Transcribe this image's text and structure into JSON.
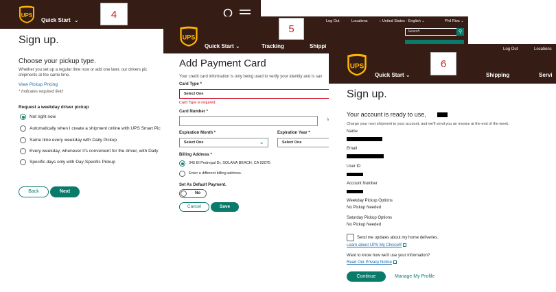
{
  "screen4": {
    "brand": "UPS",
    "nav_quick_start": "Quick Start",
    "step_number": "4",
    "title": "Sign up.",
    "subtitle": "Choose your pickup type.",
    "desc_line1": "Whether you set up a regular time now or add one later, our drivers pic",
    "desc_line2": "shipments at the same time.",
    "view_pricing": "View Pickup Pricing",
    "required_note": "* Indicates required field",
    "question": "Request a weekday driver pickup",
    "options": [
      "Not right now",
      "Automatically when I create a shipment online with UPS Smart Pic",
      "Same time every weekday with Daily Pickup",
      "Every weekday, whenever it's convenient for the driver, with Daily",
      "Specific days only with Day-Specific Pickup"
    ],
    "back_label": "Back",
    "next_label": "Next"
  },
  "screen5": {
    "brand": "UPS",
    "step_number": "5",
    "log_out": "Log Out",
    "locations": "Locations",
    "language": "United States - English",
    "user_name": "Phil Rios",
    "search_placeholder": "Search",
    "nav": [
      "Quick Start",
      "Tracking",
      "Shippi"
    ],
    "title": "Add Payment Card",
    "intro": "Your credit card information is only being used to verify your identity and is sav",
    "card_type_label": "Card Type *",
    "card_type_value": "Select One",
    "card_type_error": "Card Type is required.",
    "card_number_label": "Card Number *",
    "card_number_side": "V",
    "exp_month_label": "Expiration Month *",
    "exp_month_value": "Select One",
    "exp_year_label": "Expiration Year *",
    "exp_year_value": "Select One",
    "billing_label": "Billing Address *",
    "billing_option1": "345 El Pedregal Dr, SOLANA BEACH, CA 92075",
    "billing_option2": "Enter a different billing address.",
    "default_label": "Set As Default Payment.",
    "toggle_value": "No",
    "cancel_label": "Cancel",
    "save_label": "Save"
  },
  "screen6": {
    "brand": "UPS",
    "step_number": "6",
    "log_out": "Log Out",
    "locations": "Locations",
    "nav": [
      "Quick Start",
      "Shipping",
      "Servi"
    ],
    "title": "Sign up.",
    "ready": "Your account is ready to use,",
    "charge_note": "Charge your next shipment to your account, and we'll send you an invoice at the end of the week.",
    "name_label": "Name",
    "email_label": "Email",
    "userid_label": "User ID",
    "account_label": "Account Number",
    "weekday_label": "Weekday Pickup Options",
    "weekday_value": "No Pickup Needed",
    "saturday_label": "Saturday Pickup Options",
    "saturday_value": "No Pickup Needed",
    "updates_label": "Send me updates about my home deliveries.",
    "learn_more": "Learn about UPS My Choice®",
    "want_to_know": "Want to know how we'll use your information?",
    "privacy": "Read Our Privacy Notice",
    "continue_label": "Continue",
    "manage_label": "Manage My Profile"
  },
  "colors": {
    "brand_brown": "#351c15",
    "ups_gold": "#ffb500",
    "accent_teal": "#0a7b6b",
    "error_red": "#d0021b",
    "step_red": "#c0292a",
    "link_blue": "#1665a8"
  }
}
